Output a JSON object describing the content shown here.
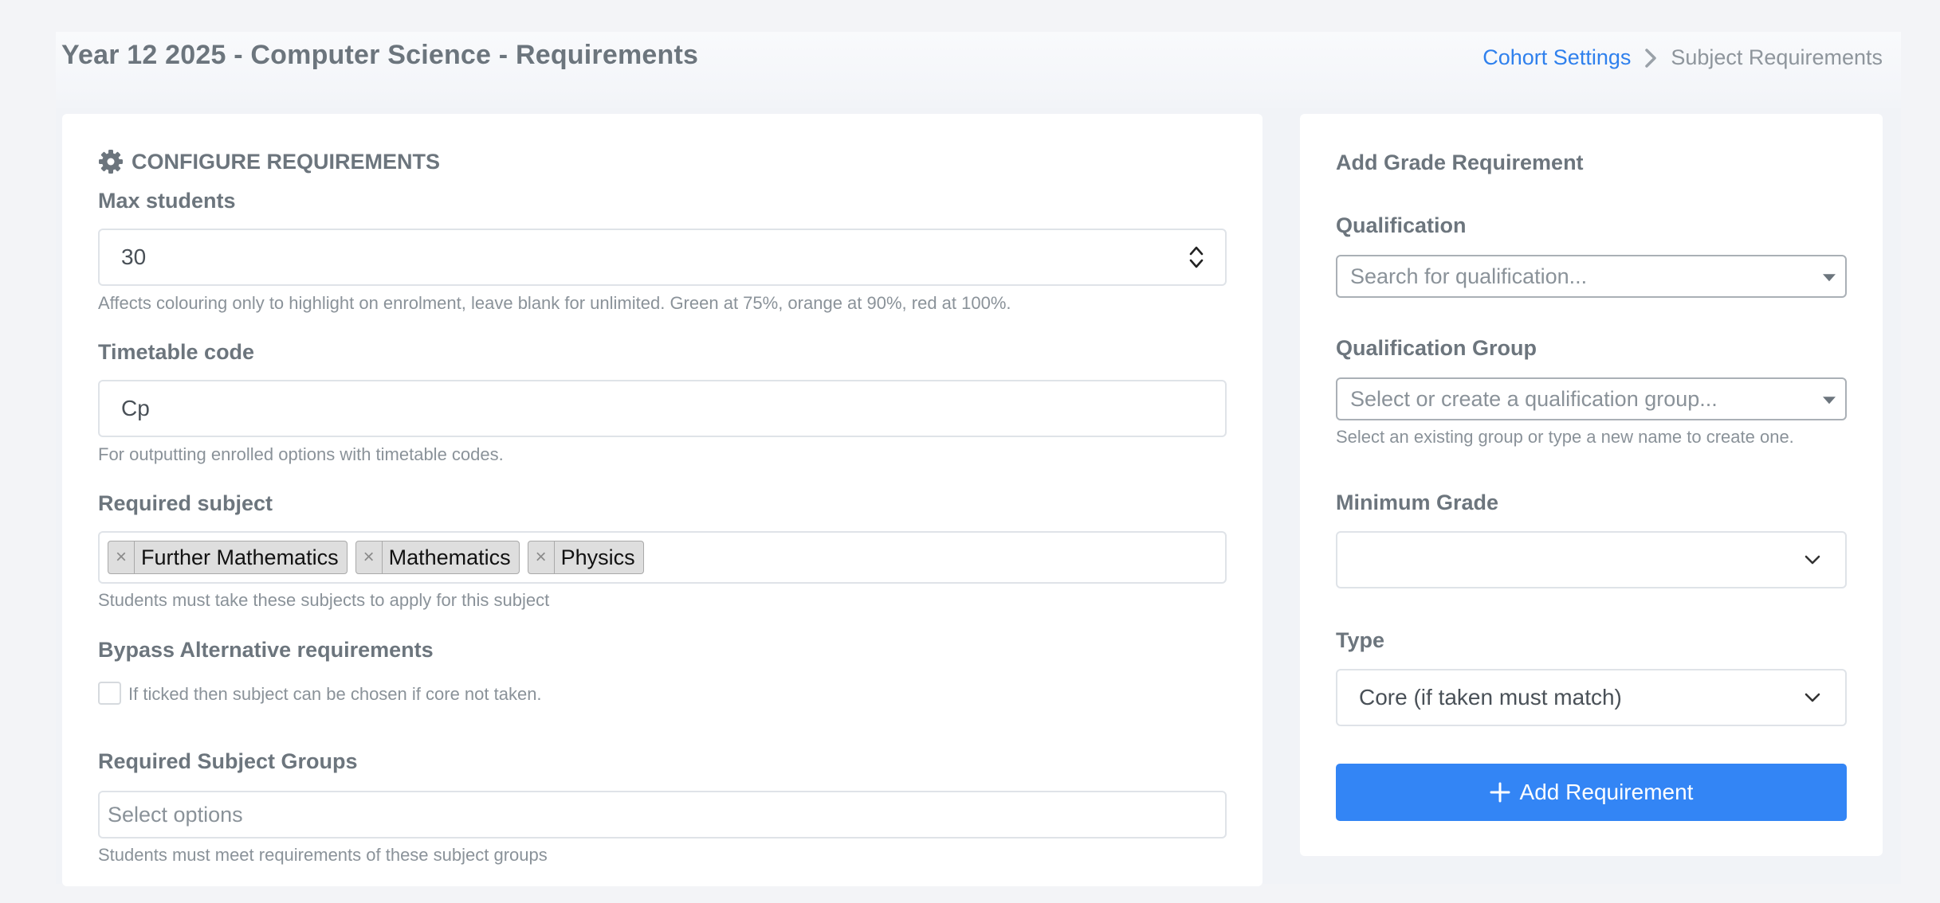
{
  "header": {
    "title": "Year 12 2025 - Computer Science - Requirements",
    "breadcrumb": {
      "link": "Cohort Settings",
      "current": "Subject Requirements"
    }
  },
  "configure": {
    "section_title": "CONFIGURE REQUIREMENTS",
    "max_students": {
      "label": "Max students",
      "value": "30",
      "help": "Affects colouring only to highlight on enrolment, leave blank for unlimited. Green at 75%, orange at 90%, red at 100%."
    },
    "timetable_code": {
      "label": "Timetable code",
      "value": "Cp",
      "help": "For outputting enrolled options with timetable codes."
    },
    "required_subject": {
      "label": "Required subject",
      "tags": [
        "Further Mathematics",
        "Mathematics",
        "Physics"
      ],
      "tag_remove": "×",
      "help": "Students must take these subjects to apply for this subject"
    },
    "bypass": {
      "label": "Bypass Alternative requirements",
      "checkbox_label": "If ticked then subject can be chosen if core not taken.",
      "checked": false
    },
    "required_groups": {
      "label": "Required Subject Groups",
      "placeholder": "Select options",
      "help": "Students must meet requirements of these subject groups"
    }
  },
  "grade_requirement": {
    "title": "Add Grade Requirement",
    "qualification": {
      "label": "Qualification",
      "placeholder": "Search for qualification..."
    },
    "qualification_group": {
      "label": "Qualification Group",
      "placeholder": "Select or create a qualification group...",
      "help": "Select an existing group or type a new name to create one."
    },
    "minimum_grade": {
      "label": "Minimum Grade",
      "value": ""
    },
    "type": {
      "label": "Type",
      "value": "Core (if taken must match)"
    },
    "add_button": "Add Requirement"
  },
  "colors": {
    "accent": "#3385f5",
    "link": "#2f80ed",
    "text": "#6c757d",
    "background": "#f3f4f7"
  },
  "icons": {
    "section_icon": "gear-icon",
    "breadcrumb_separator": "chevron-right-icon",
    "number_stepper": "up-down-arrows-icon",
    "dropdown": "chevron-down-icon",
    "add_button": "plus-icon"
  }
}
